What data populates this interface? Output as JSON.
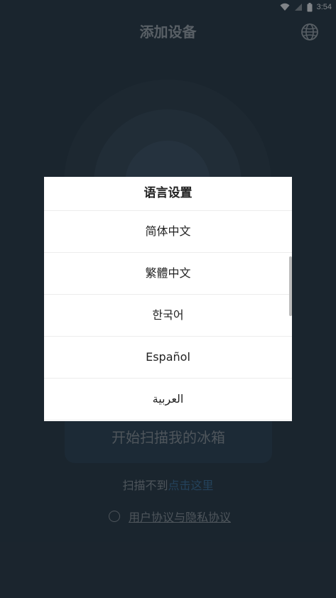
{
  "status_bar": {
    "time": "3:54",
    "icons": [
      "wifi-icon",
      "signal-icon",
      "battery-icon"
    ]
  },
  "header": {
    "title": "添加设备",
    "language_icon": "globe-icon"
  },
  "main": {
    "cta_label": "开始扫描我的冰箱",
    "hint_prefix": "扫描不到",
    "hint_link": "点击这里",
    "agreement_label": "用户协议与隐私协议"
  },
  "dialog": {
    "title": "语言设置",
    "languages": [
      {
        "label": "简体中文"
      },
      {
        "label": "繁體中文"
      },
      {
        "label": "한국어"
      },
      {
        "label": "Español"
      },
      {
        "label": "العربية"
      }
    ]
  },
  "colors": {
    "background": "#2b3c4b",
    "dialog_bg": "#ffffff",
    "link": "#3b6b93"
  }
}
